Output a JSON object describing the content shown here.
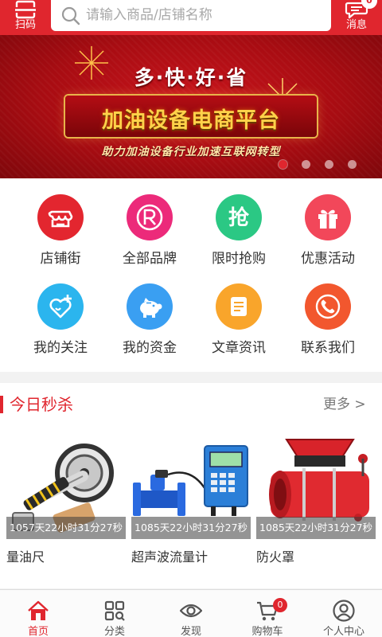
{
  "colors": {
    "brand": "#e0262e",
    "banner_gold": "#ffd24a"
  },
  "header": {
    "scan_label": "扫码",
    "message_label": "消息",
    "message_badge": "0",
    "search_placeholder": "请输入商品/店铺名称"
  },
  "banner": {
    "slogan": "多·快·好·省",
    "title": "加油设备电商平台",
    "subtitle": "助力加油设备行业加速互联网转型",
    "slide_count": 4,
    "active_slide": 1
  },
  "categories": [
    {
      "label": "店铺街",
      "icon": "storefront-icon",
      "color": "#e3262f"
    },
    {
      "label": "全部品牌",
      "icon": "registered-mark-icon",
      "color": "#ec2a7a"
    },
    {
      "label": "限时抢购",
      "icon": "grab-character-icon",
      "color": "#2bc884"
    },
    {
      "label": "优惠活动",
      "icon": "gift-icon",
      "color": "#f2475a"
    },
    {
      "label": "我的关注",
      "icon": "heart-plus-icon",
      "color": "#2bb5ee"
    },
    {
      "label": "我的资金",
      "icon": "piggy-bank-icon",
      "color": "#3a9ff2"
    },
    {
      "label": "文章资讯",
      "icon": "article-icon",
      "color": "#f9a52b"
    },
    {
      "label": "联系我们",
      "icon": "phone-icon",
      "color": "#f2572e"
    }
  ],
  "flash_sale": {
    "title": "今日秒杀",
    "more_label": "更多 >",
    "products": [
      {
        "name": "量油尺",
        "countdown": "1057天22小时31分27秒",
        "icon": "dipstick-tape-icon"
      },
      {
        "name": "超声波流量计",
        "countdown": "1085天22小时31分27秒",
        "icon": "ultrasonic-flowmeter-icon"
      },
      {
        "name": "防火罩",
        "countdown": "1085天22小时31分27秒",
        "icon": "fire-hood-icon"
      }
    ]
  },
  "tabbar": {
    "items": [
      {
        "label": "首页",
        "icon": "home-icon",
        "active": true
      },
      {
        "label": "分类",
        "icon": "category-grid-icon",
        "active": false
      },
      {
        "label": "发现",
        "icon": "eye-icon",
        "active": false
      },
      {
        "label": "购物车",
        "icon": "cart-icon",
        "active": false
      },
      {
        "label": "个人中心",
        "icon": "user-icon",
        "active": false
      }
    ],
    "cart_badge": "0"
  }
}
